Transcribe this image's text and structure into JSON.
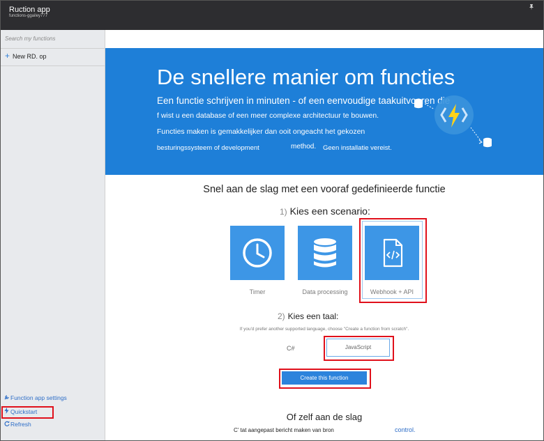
{
  "header": {
    "app_title": "Ruction app",
    "app_subtitle": "functions-ggailey777",
    "pin_icon": "pin-icon"
  },
  "sidebar": {
    "search_placeholder": "Search my functions",
    "new_function_label": "New RD. op",
    "bottom_links": [
      {
        "icon": "wrench-icon",
        "glyph": "🔧",
        "label": "Function app settings"
      },
      {
        "icon": "lightning-icon",
        "glyph": "⚡",
        "label": "Quickstart"
      },
      {
        "icon": "refresh-icon",
        "glyph": "↻",
        "label": "Refresh"
      }
    ]
  },
  "hero": {
    "title": "De snellere manier om functies",
    "line1": "Een functie schrijven in minuten - of een eenvoudige taakuitvoeren die",
    "line2": "f wist u een database of een meer complexe architectuur te bouwen.",
    "line3": "Functies maken is gemakkelijker dan ooit ongeacht het gekozen",
    "line4a": "besturingssysteem of development",
    "line4b": "method.",
    "line4c": "Geen installatie vereist."
  },
  "quickstart": {
    "title": "Snel aan de slag met een vooraf gedefinieerde functie",
    "step1_number": "1)",
    "step1_label": "Kies een scenario:",
    "scenarios": [
      {
        "name": "Timer",
        "icon": "clock-icon"
      },
      {
        "name": "Data processing",
        "icon": "database-icon"
      },
      {
        "name": "Webhook + API",
        "icon": "code-file-icon"
      }
    ],
    "step2_number": "2)",
    "step2_label": "Kies een taal:",
    "language_hint": "If you'd prefer another supported language, choose \"Create a function from scratch\".",
    "languages": [
      "C#",
      "JavaScript"
    ],
    "create_button": "Create this function"
  },
  "own": {
    "title": "Of zelf aan de slag",
    "line": "C' tat aangepast bericht maken van bron",
    "link": "control."
  },
  "colors": {
    "hero": "#1e7fd8",
    "tile": "#3d96e6",
    "highlight": "#e0101b",
    "topbar": "#2d2d30"
  }
}
